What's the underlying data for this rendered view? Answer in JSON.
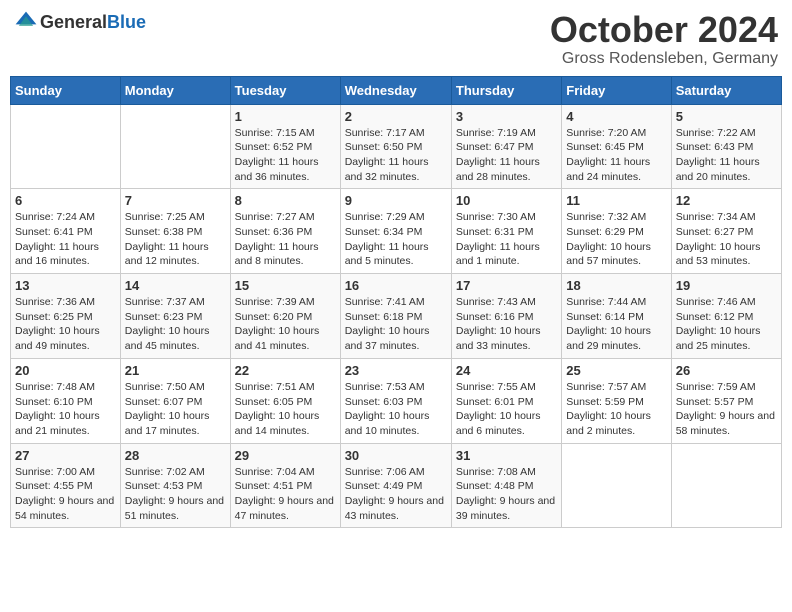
{
  "header": {
    "logo_general": "General",
    "logo_blue": "Blue",
    "month_title": "October 2024",
    "location": "Gross Rodensleben, Germany"
  },
  "days_of_week": [
    "Sunday",
    "Monday",
    "Tuesday",
    "Wednesday",
    "Thursday",
    "Friday",
    "Saturday"
  ],
  "weeks": [
    [
      {
        "day": "",
        "info": ""
      },
      {
        "day": "",
        "info": ""
      },
      {
        "day": "1",
        "info": "Sunrise: 7:15 AM\nSunset: 6:52 PM\nDaylight: 11 hours and 36 minutes."
      },
      {
        "day": "2",
        "info": "Sunrise: 7:17 AM\nSunset: 6:50 PM\nDaylight: 11 hours and 32 minutes."
      },
      {
        "day": "3",
        "info": "Sunrise: 7:19 AM\nSunset: 6:47 PM\nDaylight: 11 hours and 28 minutes."
      },
      {
        "day": "4",
        "info": "Sunrise: 7:20 AM\nSunset: 6:45 PM\nDaylight: 11 hours and 24 minutes."
      },
      {
        "day": "5",
        "info": "Sunrise: 7:22 AM\nSunset: 6:43 PM\nDaylight: 11 hours and 20 minutes."
      }
    ],
    [
      {
        "day": "6",
        "info": "Sunrise: 7:24 AM\nSunset: 6:41 PM\nDaylight: 11 hours and 16 minutes."
      },
      {
        "day": "7",
        "info": "Sunrise: 7:25 AM\nSunset: 6:38 PM\nDaylight: 11 hours and 12 minutes."
      },
      {
        "day": "8",
        "info": "Sunrise: 7:27 AM\nSunset: 6:36 PM\nDaylight: 11 hours and 8 minutes."
      },
      {
        "day": "9",
        "info": "Sunrise: 7:29 AM\nSunset: 6:34 PM\nDaylight: 11 hours and 5 minutes."
      },
      {
        "day": "10",
        "info": "Sunrise: 7:30 AM\nSunset: 6:31 PM\nDaylight: 11 hours and 1 minute."
      },
      {
        "day": "11",
        "info": "Sunrise: 7:32 AM\nSunset: 6:29 PM\nDaylight: 10 hours and 57 minutes."
      },
      {
        "day": "12",
        "info": "Sunrise: 7:34 AM\nSunset: 6:27 PM\nDaylight: 10 hours and 53 minutes."
      }
    ],
    [
      {
        "day": "13",
        "info": "Sunrise: 7:36 AM\nSunset: 6:25 PM\nDaylight: 10 hours and 49 minutes."
      },
      {
        "day": "14",
        "info": "Sunrise: 7:37 AM\nSunset: 6:23 PM\nDaylight: 10 hours and 45 minutes."
      },
      {
        "day": "15",
        "info": "Sunrise: 7:39 AM\nSunset: 6:20 PM\nDaylight: 10 hours and 41 minutes."
      },
      {
        "day": "16",
        "info": "Sunrise: 7:41 AM\nSunset: 6:18 PM\nDaylight: 10 hours and 37 minutes."
      },
      {
        "day": "17",
        "info": "Sunrise: 7:43 AM\nSunset: 6:16 PM\nDaylight: 10 hours and 33 minutes."
      },
      {
        "day": "18",
        "info": "Sunrise: 7:44 AM\nSunset: 6:14 PM\nDaylight: 10 hours and 29 minutes."
      },
      {
        "day": "19",
        "info": "Sunrise: 7:46 AM\nSunset: 6:12 PM\nDaylight: 10 hours and 25 minutes."
      }
    ],
    [
      {
        "day": "20",
        "info": "Sunrise: 7:48 AM\nSunset: 6:10 PM\nDaylight: 10 hours and 21 minutes."
      },
      {
        "day": "21",
        "info": "Sunrise: 7:50 AM\nSunset: 6:07 PM\nDaylight: 10 hours and 17 minutes."
      },
      {
        "day": "22",
        "info": "Sunrise: 7:51 AM\nSunset: 6:05 PM\nDaylight: 10 hours and 14 minutes."
      },
      {
        "day": "23",
        "info": "Sunrise: 7:53 AM\nSunset: 6:03 PM\nDaylight: 10 hours and 10 minutes."
      },
      {
        "day": "24",
        "info": "Sunrise: 7:55 AM\nSunset: 6:01 PM\nDaylight: 10 hours and 6 minutes."
      },
      {
        "day": "25",
        "info": "Sunrise: 7:57 AM\nSunset: 5:59 PM\nDaylight: 10 hours and 2 minutes."
      },
      {
        "day": "26",
        "info": "Sunrise: 7:59 AM\nSunset: 5:57 PM\nDaylight: 9 hours and 58 minutes."
      }
    ],
    [
      {
        "day": "27",
        "info": "Sunrise: 7:00 AM\nSunset: 4:55 PM\nDaylight: 9 hours and 54 minutes."
      },
      {
        "day": "28",
        "info": "Sunrise: 7:02 AM\nSunset: 4:53 PM\nDaylight: 9 hours and 51 minutes."
      },
      {
        "day": "29",
        "info": "Sunrise: 7:04 AM\nSunset: 4:51 PM\nDaylight: 9 hours and 47 minutes."
      },
      {
        "day": "30",
        "info": "Sunrise: 7:06 AM\nSunset: 4:49 PM\nDaylight: 9 hours and 43 minutes."
      },
      {
        "day": "31",
        "info": "Sunrise: 7:08 AM\nSunset: 4:48 PM\nDaylight: 9 hours and 39 minutes."
      },
      {
        "day": "",
        "info": ""
      },
      {
        "day": "",
        "info": ""
      }
    ]
  ]
}
